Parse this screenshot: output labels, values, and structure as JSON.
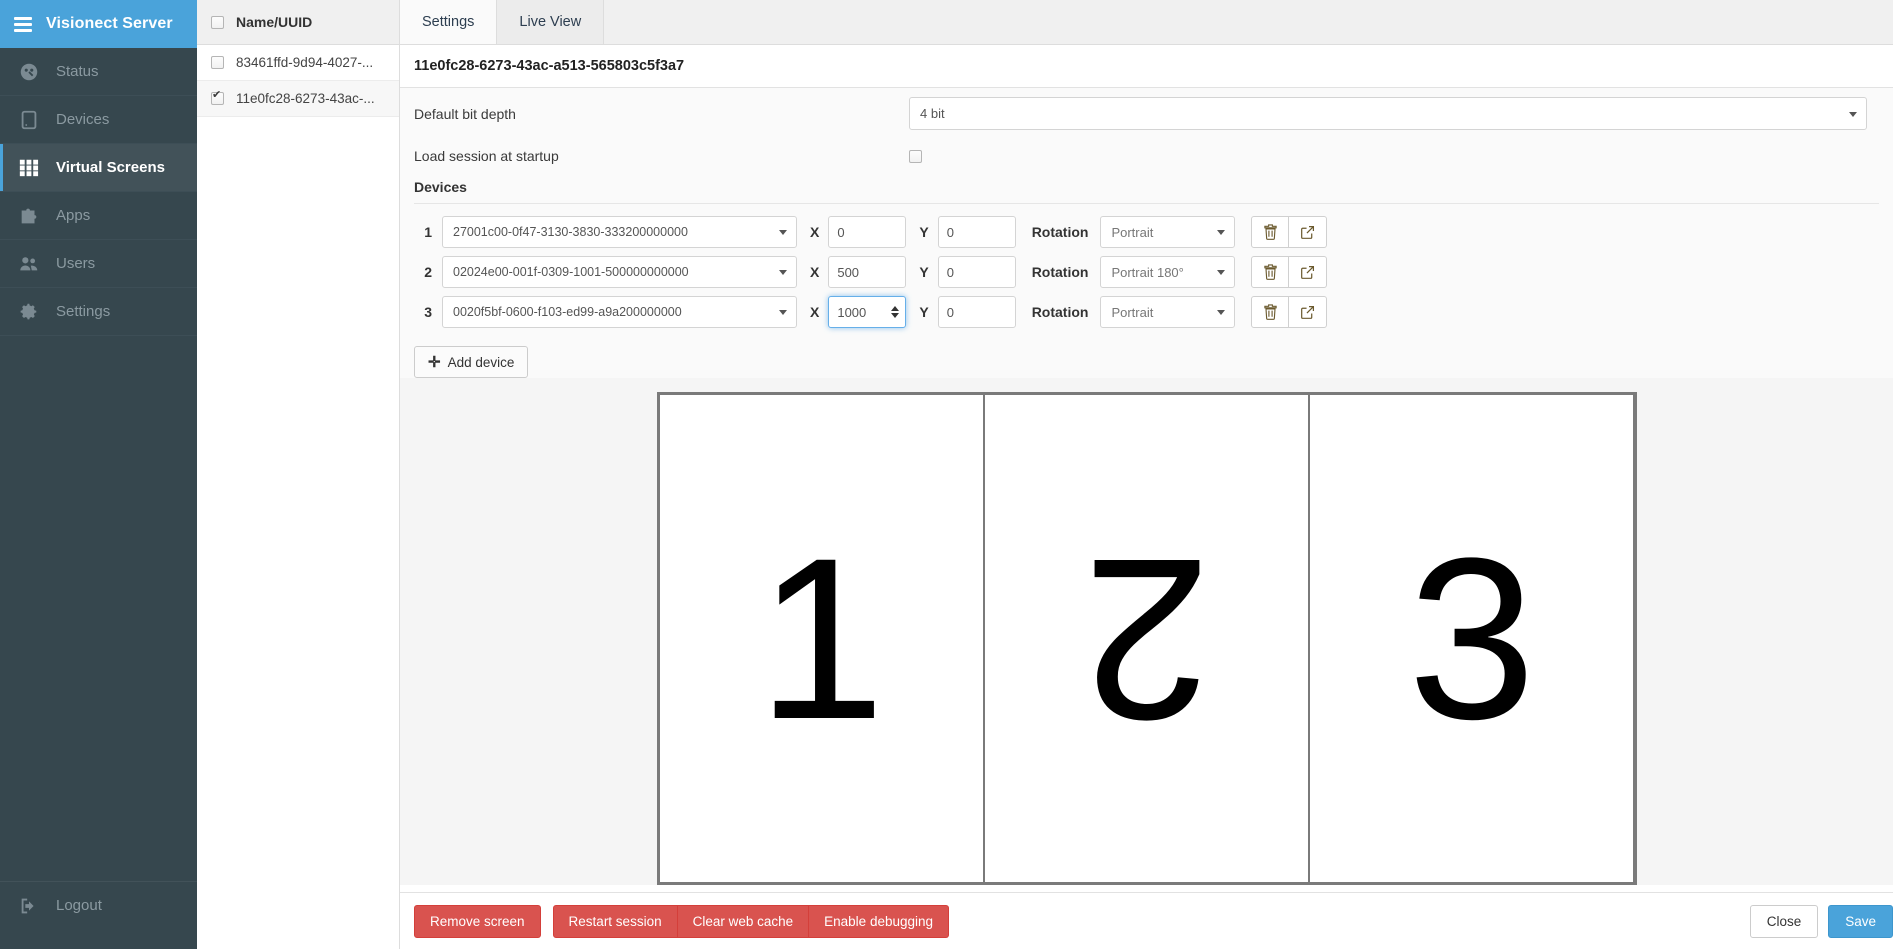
{
  "sidebar": {
    "brand": "Visionect Server",
    "items": [
      {
        "label": "Status",
        "icon": "gauge-icon",
        "active": false
      },
      {
        "label": "Devices",
        "icon": "tablet-icon",
        "active": false
      },
      {
        "label": "Virtual Screens",
        "icon": "grid-icon",
        "active": true
      },
      {
        "label": "Apps",
        "icon": "puzzle-icon",
        "active": false
      },
      {
        "label": "Users",
        "icon": "users-icon",
        "active": false
      },
      {
        "label": "Settings",
        "icon": "gear-icon",
        "active": false
      }
    ],
    "logout": "Logout"
  },
  "list": {
    "header": "Name/UUID",
    "rows": [
      {
        "label": "83461ffd-9d94-4027-...",
        "checked": false
      },
      {
        "label": "11e0fc28-6273-43ac-...",
        "checked": true
      }
    ]
  },
  "tabs": [
    {
      "label": "Settings",
      "active": true
    },
    {
      "label": "Live View",
      "active": false
    }
  ],
  "detail": {
    "title": "11e0fc28-6273-43ac-a513-565803c5f3a7",
    "bit_depth_label": "Default bit depth",
    "bit_depth_value": "4 bit",
    "load_session_label": "Load session at startup",
    "load_session_checked": false,
    "devices_heading": "Devices",
    "x_label": "X",
    "y_label": "Y",
    "rotation_label": "Rotation",
    "add_device_label": "Add device",
    "devices": [
      {
        "index": "1",
        "uuid": "27001c00-0f47-3130-3830-333200000000",
        "x": "0",
        "y": "0",
        "rotation": "Portrait",
        "focused": false
      },
      {
        "index": "2",
        "uuid": "02024e00-001f-0309-1001-500000000000",
        "x": "500",
        "y": "0",
        "rotation": "Portrait 180°",
        "focused": false
      },
      {
        "index": "3",
        "uuid": "0020f5bf-0600-f103-ed99-a9a200000000",
        "x": "1000",
        "y": "0",
        "rotation": "Portrait",
        "focused": true
      }
    ]
  },
  "preview": {
    "screens": [
      {
        "digit": "1",
        "rotated": false
      },
      {
        "digit": "2",
        "rotated": true
      },
      {
        "digit": "3",
        "rotated": false
      }
    ]
  },
  "footer": {
    "remove_screen": "Remove screen",
    "restart_session": "Restart session",
    "clear_web_cache": "Clear web cache",
    "enable_debugging": "Enable debugging",
    "close": "Close",
    "save": "Save"
  },
  "colors": {
    "brand_blue": "#4aa3da",
    "sidebar_bg": "#36474e",
    "sidebar_active": "#425259",
    "danger": "#d9534f"
  }
}
